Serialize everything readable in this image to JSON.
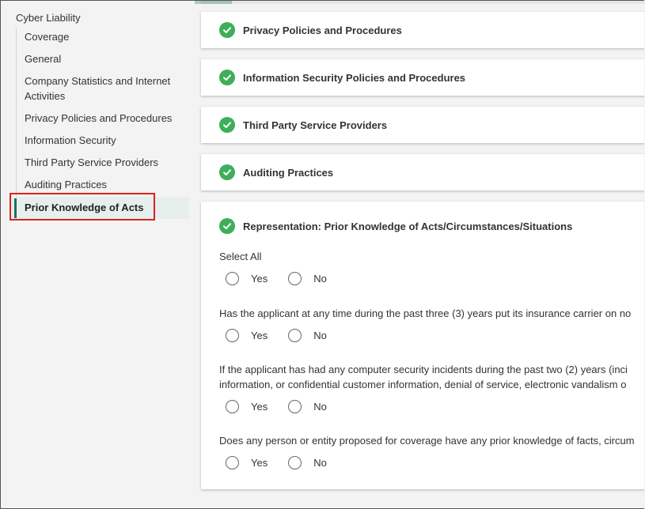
{
  "sidebar": {
    "title": "Cyber Liability",
    "items": [
      {
        "label": "Coverage"
      },
      {
        "label": "General"
      },
      {
        "label": "Company Statistics and Internet Activities"
      },
      {
        "label": "Privacy Policies and Procedures"
      },
      {
        "label": "Information Security"
      },
      {
        "label": "Third Party Service Providers"
      },
      {
        "label": "Auditing Practices"
      },
      {
        "label": "Prior Knowledge of Acts"
      }
    ],
    "active_index": 7
  },
  "sections": [
    {
      "title": "Privacy Policies and Procedures",
      "status": "complete"
    },
    {
      "title": "Information Security Policies and Procedures",
      "status": "complete"
    },
    {
      "title": "Third Party Service Providers",
      "status": "complete"
    },
    {
      "title": "Auditing Practices",
      "status": "complete"
    }
  ],
  "representation": {
    "title": "Representation: Prior Knowledge of Acts/Circumstances/Situations",
    "status": "complete",
    "select_all_label": "Select All",
    "questions": [
      {
        "line1": "Has the applicant at any time during the past three (3) years put its insurance carrier on no",
        "line2": ""
      },
      {
        "line1": "If the applicant has had any computer security incidents during the past two (2) years (inci",
        "line2": "information, or confidential customer information, denial of service, electronic vandalism o"
      },
      {
        "line1": "Does any person or entity proposed for coverage have any prior knowledge of facts, circum",
        "line2": ""
      }
    ],
    "yes_label": "Yes",
    "no_label": "No"
  },
  "colors": {
    "check_green": "#3fae5a",
    "active_bar": "#1f6f5a",
    "highlight_box": "#e02020"
  }
}
